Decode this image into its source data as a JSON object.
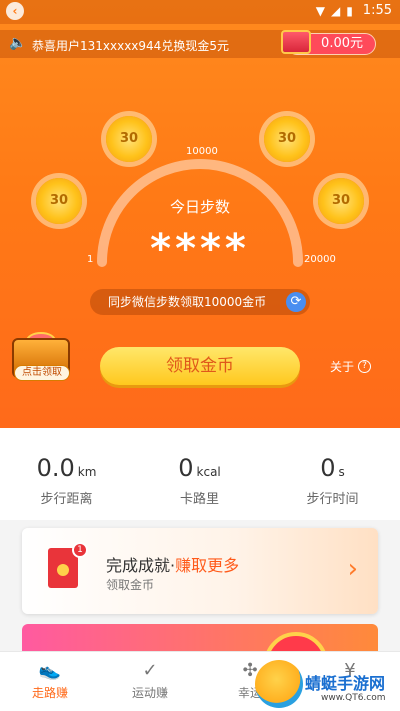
{
  "status_bar": {
    "time": "1:55",
    "back_icon": "back-icon"
  },
  "notice": {
    "message": "恭喜用户131xxxxx944兑换现金5元",
    "wallet_amount": "0.00元"
  },
  "gauge": {
    "coins": [
      "30",
      "30",
      "30",
      "30"
    ],
    "tick_labels": {
      "min": "1",
      "mid": "10000",
      "max": "20000"
    },
    "title": "今日步数",
    "steps": "****"
  },
  "sync": {
    "label": "同步微信步数领取10000金币"
  },
  "treasure": {
    "label": "点击领取"
  },
  "collect_button": "领取金币",
  "about": {
    "label": "关于",
    "icon": "?"
  },
  "stats": [
    {
      "value": "0.0",
      "unit": "km",
      "label": "步行距离"
    },
    {
      "value": "0",
      "unit": "kcal",
      "label": "卡路里"
    },
    {
      "value": "0",
      "unit": "s",
      "label": "步行时间"
    }
  ],
  "achievement": {
    "title": "完成成就·",
    "highlight": "赚取更多",
    "subtitle": "领取金币",
    "badge": "1"
  },
  "nav": [
    {
      "label": "走路赚",
      "active": true
    },
    {
      "label": "运动赚",
      "active": false
    },
    {
      "label": "幸运",
      "active": false
    },
    {
      "label": "",
      "active": false
    }
  ],
  "watermark": {
    "name": "蜻蜓手游网",
    "url": "www.QT6.com"
  },
  "colors": {
    "accent": "#ff7a16",
    "nav_active": "#ff6a1a",
    "coin": "#ffc21a"
  }
}
